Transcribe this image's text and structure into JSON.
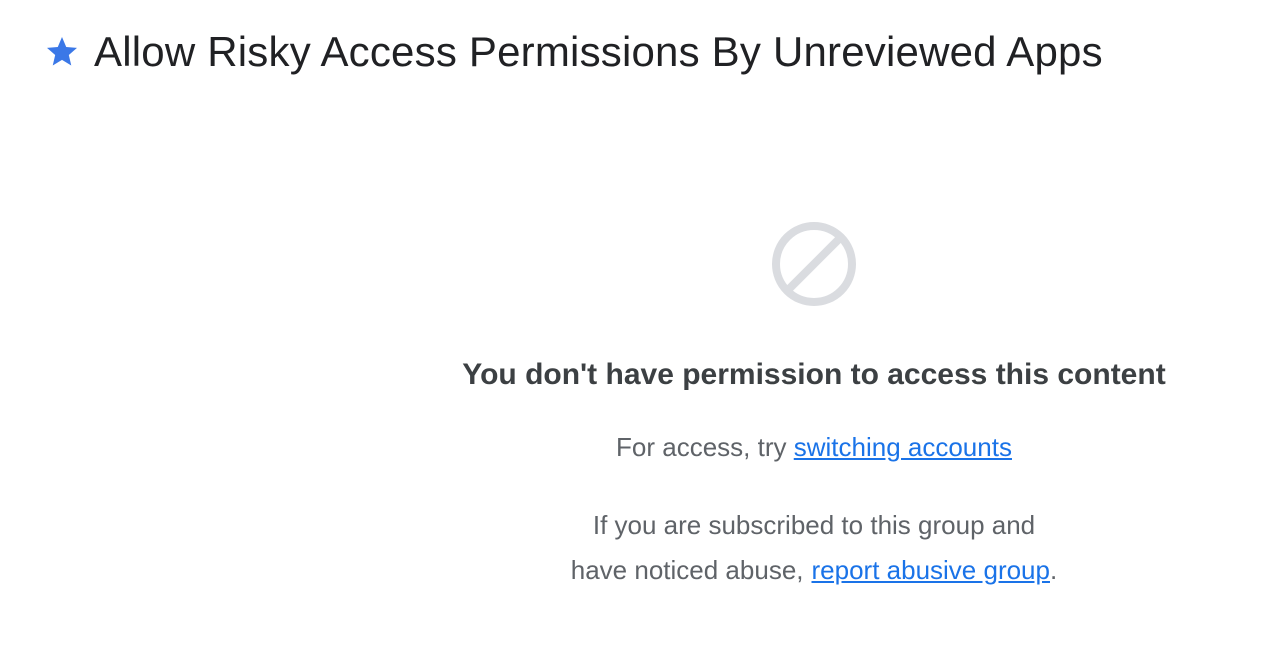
{
  "colors": {
    "accent": "#1a73e8",
    "star": "#3b78e7",
    "icon_gray": "#dadce0",
    "text_dark": "#3c4043",
    "text_muted": "#5f6368"
  },
  "header": {
    "icon": "star-icon",
    "title": "Allow Risky Access Permissions By Unreviewed Apps"
  },
  "content": {
    "icon": "block-icon",
    "heading": "You don't have permission to access this content",
    "access_prefix": "For access, try",
    "switch_link": "switching accounts",
    "abuse_line1": "If you are subscribed to this group and",
    "abuse_prefix": "have noticed abuse,",
    "report_link": "report abusive group",
    "abuse_suffix": "."
  }
}
